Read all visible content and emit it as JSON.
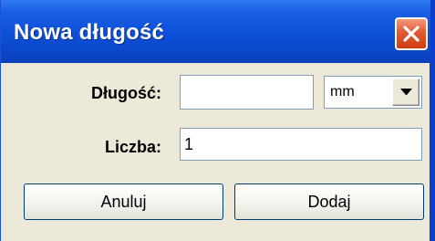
{
  "dialog": {
    "title": "Nowa długość",
    "close_icon": "close-icon"
  },
  "form": {
    "length_label": "Długość:",
    "length_value": "",
    "unit": {
      "selected": "mm",
      "icon": "chevron-down-icon"
    },
    "count_label": "Liczba:",
    "count_value": "1"
  },
  "buttons": {
    "cancel_label": "Anuluj",
    "add_label": "Dodaj"
  },
  "colors": {
    "titlebar": "#0c4fd7",
    "close_button": "#e25a33",
    "dialog_background": "#ece9d8"
  }
}
